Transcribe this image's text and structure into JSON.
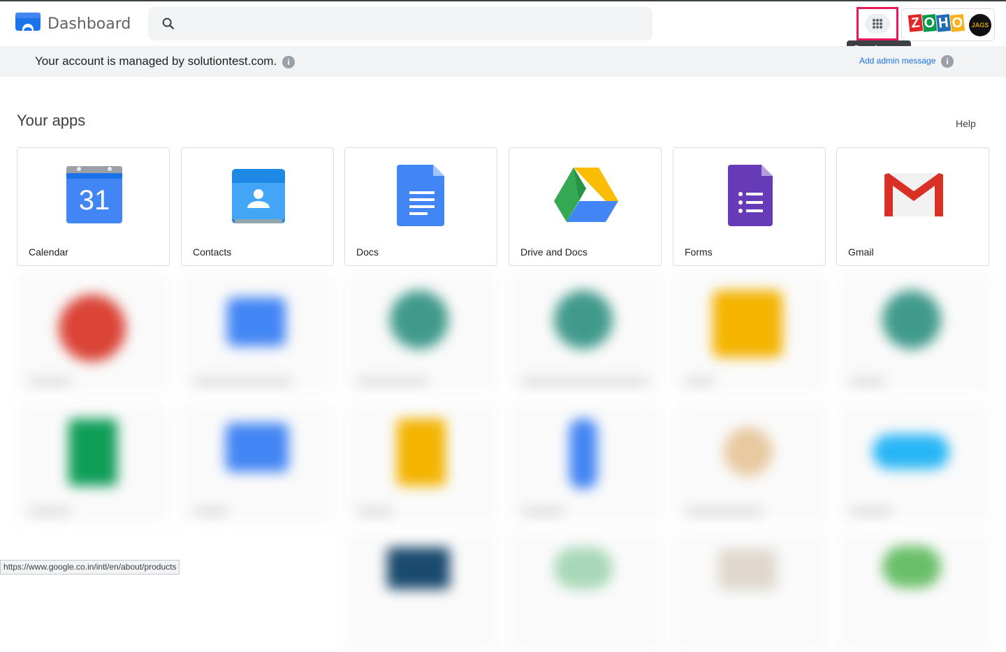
{
  "header": {
    "title": "Dashboard",
    "search_icon": "search-icon",
    "apps_icon": "apps-grid-icon",
    "apps_tooltip": "Google apps",
    "brand_text": [
      "Z",
      "O",
      "H",
      "O"
    ],
    "brand_colors": [
      "#e42527",
      "#089949",
      "#226db4",
      "#f9b21d"
    ],
    "profile_text": "JAGS"
  },
  "banner": {
    "managed_text": "Your account is managed by solutiontest.com.",
    "info_icon": "i",
    "admin_link": "Add admin message",
    "admin_info_icon": "i"
  },
  "apps_section": {
    "title": "Your apps",
    "help": "Help",
    "apps": [
      {
        "label": "Calendar",
        "icon": "calendar-icon",
        "day": "31"
      },
      {
        "label": "Contacts",
        "icon": "contacts-icon"
      },
      {
        "label": "Docs",
        "icon": "docs-icon"
      },
      {
        "label": "Drive and Docs",
        "icon": "drive-icon"
      },
      {
        "label": "Forms",
        "icon": "forms-icon"
      },
      {
        "label": "Gmail",
        "icon": "gmail-icon"
      }
    ]
  },
  "status_url": "https://www.google.co.in/intl/en/about/products",
  "colors": {
    "accent_highlight": "#e8195a",
    "link": "#1a73e8",
    "banner_bg": "#f1f3f4"
  }
}
